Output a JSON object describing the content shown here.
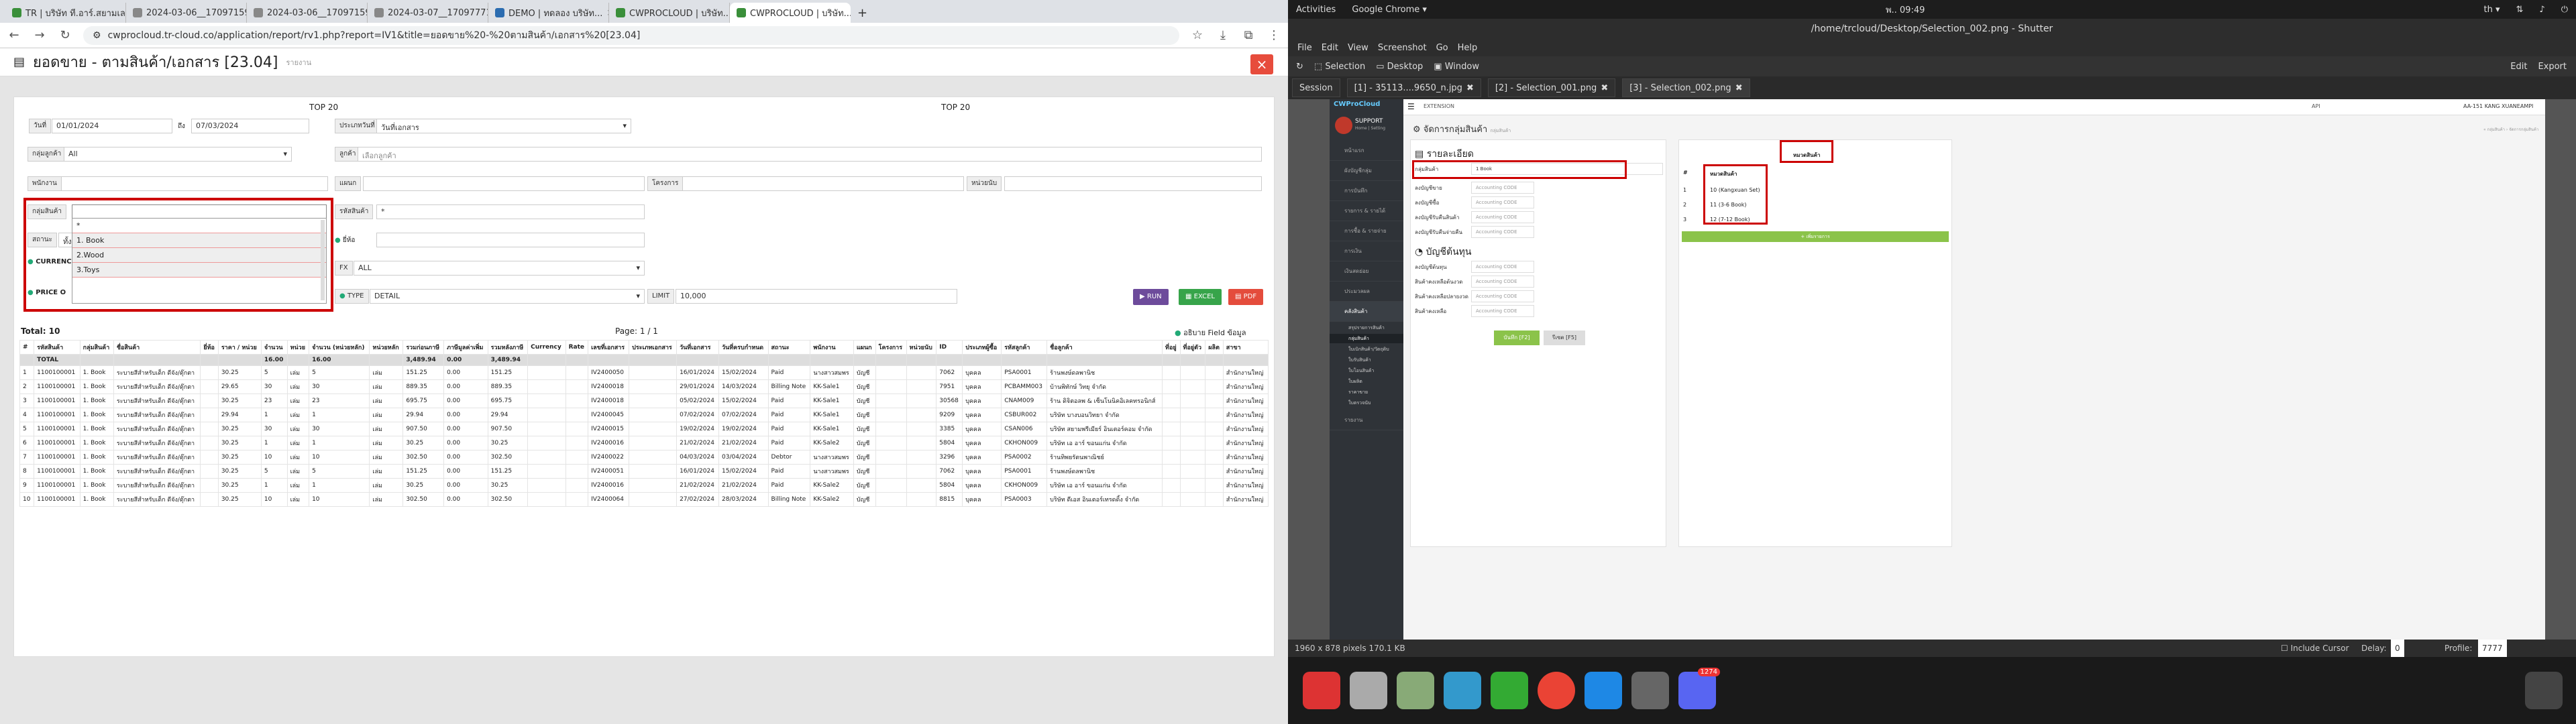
{
  "browser": {
    "tabs": [
      {
        "label": "TR | บริษัท ที.อาร์.สยามเล..."
      },
      {
        "label": "2024-03-06__17097159..."
      },
      {
        "label": "2024-03-06__17097159..."
      },
      {
        "label": "2024-03-07__17097771..."
      },
      {
        "label": "DEMO | ทดลอง บริษัท..."
      },
      {
        "label": "CWPROCLOUD | บริษัท..."
      },
      {
        "label": "CWPROCLOUD | บริษัท..."
      }
    ],
    "url": "cwprocloud.tr-cloud.co/application/report/rv1.php?report=IV1&title=ยอดขาย%20-%20ตามสินค้า/เอกสาร%20[23.04]"
  },
  "report": {
    "title": "ยอดขาย - ตามสินค้า/เอกสาร [23.04]",
    "subtitle": "รายงาน",
    "close": "×",
    "top20_left": "TOP 20",
    "top20_right": "TOP 20",
    "date_label": "วันที่",
    "date_from": "01/01/2024",
    "date_to_label": "ถึง",
    "date_to": "07/03/2024",
    "date_type_label": "ประเภทวันที่",
    "date_type_value": "วันที่เอกสาร",
    "customer_group_label": "กลุ่มลูกค้า",
    "customer_group_value": "All",
    "customer_label": "ลูกค้า",
    "customer_placeholder": "เลือกลูกค้า",
    "salesman_label": "พนักงาน",
    "dept_label": "แผนก",
    "project_label": "โครงการ",
    "job_label": "หน่วยนับ",
    "product_group_label": "กลุ่มสินค้า",
    "product_code_label": "รหัสสินค้า",
    "product_code_value": "*",
    "status_label": "สถานะ",
    "status_value": "ทั้งหมด",
    "dropdown_options": [
      "*",
      "1. Book",
      "2.Wood",
      "3.Toys"
    ],
    "currency_label": "CURRENCY",
    "price_label": "PRICE O",
    "brand_label": "ยี่ห้อ",
    "fx_label": "FX",
    "fx_value": "ALL",
    "type_label": "TYPE",
    "type_value": "DETAIL",
    "limit_label": "LIMIT",
    "limit_value": "10,000",
    "run": "RUN",
    "excel": "EXCEL",
    "pdf": "PDF",
    "total": "Total: 10",
    "page_label": "Page:",
    "page_value": "1",
    "page_of": "/ 1",
    "field_help": "อธิบาย Field ข้อมูล"
  },
  "table": {
    "headers": [
      "#",
      "รหัสสินค้า",
      "กลุ่มสินค้า",
      "ชื่อสินค้า",
      "ยี่ห้อ",
      "ราคา / หน่วย",
      "จำนวน",
      "หน่วย",
      "จำนวน (หน่วยหลัก)",
      "หน่วยหลัก",
      "รวมก่อนภาษี",
      "ภาษีมูลค่าเพิ่ม",
      "รวมหลังภาษี",
      "Currency",
      "Rate",
      "เลขที่เอกสาร",
      "ประเภทเอกสาร",
      "วันที่เอกสาร",
      "วันที่ครบกำหนด",
      "สถานะ",
      "พนักงาน",
      "แผนก",
      "โครงการ",
      "หน่วยนับ",
      "ID",
      "ประเภทผู้ซื้อ",
      "รหัสลูกค้า",
      "ชื่อลูกค้า",
      "ที่อยู่",
      "ที่อยู่ตัว",
      "ผลิต",
      "สาขา"
    ],
    "total_row": [
      "",
      "TOTAL",
      "",
      "",
      "",
      "",
      "16.00",
      "",
      "16.00",
      "",
      "3,489.94",
      "0.00",
      "3,489.94",
      "",
      "",
      "",
      "",
      "",
      "",
      "",
      "",
      "",
      "",
      "",
      "",
      "",
      "",
      "",
      "",
      "",
      "",
      ""
    ],
    "rows": [
      [
        "1",
        "1100100001",
        "1. Book",
        "ระบายสีสำหรับเด็ก ดีจัง/ตุ๊กตา",
        "",
        "30.25",
        "5",
        "เล่ม",
        "5",
        "เล่ม",
        "151.25",
        "0.00",
        "151.25",
        "",
        "",
        "IV2400050",
        "",
        "16/01/2024",
        "15/02/2024",
        "Paid",
        "นางสาวสมพร",
        "บัญชี",
        "",
        "",
        "7062",
        "บุคคล",
        "PSA0001",
        "ร้านพงษ์ดลพานิช",
        "",
        "",
        "",
        "สำนักงานใหญ่"
      ],
      [
        "2",
        "1100100001",
        "1. Book",
        "ระบายสีสำหรับเด็ก ดีจัง/ตุ๊กตา",
        "",
        "29.65",
        "30",
        "เล่ม",
        "30",
        "เล่ม",
        "889.35",
        "0.00",
        "889.35",
        "",
        "",
        "IV2400018",
        "",
        "29/01/2024",
        "14/03/2024",
        "Billing Note",
        "KK-Sale1",
        "บัญชี",
        "",
        "",
        "7951",
        "บุคคล",
        "PCBAMM003",
        "บ้านพิทักษ์ วิทยุ จำกัด",
        "",
        "",
        "",
        "สำนักงานใหญ่"
      ],
      [
        "3",
        "1100100001",
        "1. Book",
        "ระบายสีสำหรับเด็ก ดีจัง/ตุ๊กตา",
        "",
        "30.25",
        "23",
        "เล่ม",
        "23",
        "เล่ม",
        "695.75",
        "0.00",
        "695.75",
        "",
        "",
        "IV2400018",
        "",
        "05/02/2024",
        "15/02/2024",
        "Paid",
        "KK-Sale1",
        "บัญชี",
        "",
        "",
        "30568",
        "บุคคล",
        "CNAM009",
        "ร้าน ดิจิตอลพ & เซ็นโนนิคอิเลคทรอนิกส์",
        "",
        "",
        "",
        "สำนักงานใหญ่"
      ],
      [
        "4",
        "1100100001",
        "1. Book",
        "ระบายสีสำหรับเด็ก ดีจัง/ตุ๊กตา",
        "",
        "29.94",
        "1",
        "เล่ม",
        "1",
        "เล่ม",
        "29.94",
        "0.00",
        "29.94",
        "",
        "",
        "IV2400045",
        "",
        "07/02/2024",
        "07/02/2024",
        "Paid",
        "KK-Sale1",
        "บัญชี",
        "",
        "",
        "9209",
        "บุคคล",
        "CSBUR002",
        "บริษัท บางบอนวิทยา จำกัด",
        "",
        "",
        "",
        "สำนักงานใหญ่"
      ],
      [
        "5",
        "1100100001",
        "1. Book",
        "ระบายสีสำหรับเด็ก ดีจัง/ตุ๊กตา",
        "",
        "30.25",
        "30",
        "เล่ม",
        "30",
        "เล่ม",
        "907.50",
        "0.00",
        "907.50",
        "",
        "",
        "IV2400015",
        "",
        "19/02/2024",
        "19/02/2024",
        "Paid",
        "KK-Sale1",
        "บัญชี",
        "",
        "",
        "3385",
        "บุคคล",
        "CSAN006",
        "บริษัท สยามพรีเมียร์ อินเตอร์คอม จำกัด",
        "",
        "",
        "",
        "สำนักงานใหญ่"
      ],
      [
        "6",
        "1100100001",
        "1. Book",
        "ระบายสีสำหรับเด็ก ดีจัง/ตุ๊กตา",
        "",
        "30.25",
        "1",
        "เล่ม",
        "1",
        "เล่ม",
        "30.25",
        "0.00",
        "30.25",
        "",
        "",
        "IV2400016",
        "",
        "21/02/2024",
        "21/02/2024",
        "Paid",
        "KK-Sale2",
        "บัญชี",
        "",
        "",
        "5804",
        "บุคคล",
        "CKHON009",
        "บริษัท เอ อาร์ ขอนแก่น จำกัด",
        "",
        "",
        "",
        "สำนักงานใหญ่"
      ],
      [
        "7",
        "1100100001",
        "1. Book",
        "ระบายสีสำหรับเด็ก ดีจัง/ตุ๊กตา",
        "",
        "30.25",
        "10",
        "เล่ม",
        "10",
        "เล่ม",
        "302.50",
        "0.00",
        "302.50",
        "",
        "",
        "IV2400022",
        "",
        "04/03/2024",
        "03/04/2024",
        "Debtor",
        "นางสาวสมพร",
        "บัญชี",
        "",
        "",
        "3296",
        "บุคคล",
        "PSA0002",
        "ร้านทิพยรัตนพาณิชย์",
        "",
        "",
        "",
        "สำนักงานใหญ่"
      ],
      [
        "8",
        "1100100001",
        "1. Book",
        "ระบายสีสำหรับเด็ก ดีจัง/ตุ๊กตา",
        "",
        "30.25",
        "5",
        "เล่ม",
        "5",
        "เล่ม",
        "151.25",
        "0.00",
        "151.25",
        "",
        "",
        "IV2400051",
        "",
        "16/01/2024",
        "15/02/2024",
        "Paid",
        "นางสาวสมพร",
        "บัญชี",
        "",
        "",
        "7062",
        "บุคคล",
        "PSA0001",
        "ร้านพงษ์ดลพานิช",
        "",
        "",
        "",
        "สำนักงานใหญ่"
      ],
      [
        "9",
        "1100100001",
        "1. Book",
        "ระบายสีสำหรับเด็ก ดีจัง/ตุ๊กตา",
        "",
        "30.25",
        "1",
        "เล่ม",
        "1",
        "เล่ม",
        "30.25",
        "0.00",
        "30.25",
        "",
        "",
        "IV2400016",
        "",
        "21/02/2024",
        "21/02/2024",
        "Paid",
        "KK-Sale2",
        "บัญชี",
        "",
        "",
        "5804",
        "บุคคล",
        "CKHON009",
        "บริษัท เอ อาร์ ขอนแก่น จำกัด",
        "",
        "",
        "",
        "สำนักงานใหญ่"
      ],
      [
        "10",
        "1100100001",
        "1. Book",
        "ระบายสีสำหรับเด็ก ดีจัง/ตุ๊กตา",
        "",
        "30.25",
        "10",
        "เล่ม",
        "10",
        "เล่ม",
        "302.50",
        "0.00",
        "302.50",
        "",
        "",
        "IV2400064",
        "",
        "27/02/2024",
        "28/03/2024",
        "Billing Note",
        "KK-Sale2",
        "บัญชี",
        "",
        "",
        "8815",
        "บุคคล",
        "PSA0003",
        "บริษัท ดีเอส อินเตอร์เทรดดิ้ง จำกัด",
        "",
        "",
        "",
        "สำนักงานใหญ่"
      ]
    ]
  },
  "ubuntu": {
    "activities": "Activities",
    "app": "Google Chrome ▾",
    "clock": "พ.. 09:49",
    "lang": "th ▾",
    "shutter_title": "/home/trcloud/Desktop/Selection_002.png - Shutter",
    "menu": [
      "File",
      "Edit",
      "View",
      "Screenshot",
      "Go",
      "Help"
    ],
    "tools": [
      "Selection",
      "Desktop",
      "Window"
    ],
    "edit": "Edit",
    "export": "Export",
    "session_tab": "Session",
    "file_tabs": [
      "[1] - 35113....9650_n.jpg",
      "[2] - Selection_001.png",
      "[3] - Selection_002.png"
    ],
    "status": "1960 x 878 pixels  170.1 KB",
    "include_cursor": "Include Cursor",
    "delay_label": "Delay:",
    "delay_value": "0",
    "profile_label": "Profile:",
    "profile_value": "7777",
    "badge": "1274"
  },
  "erp": {
    "logo": "CWProCloud",
    "extension": "EXTENSION",
    "api": "API",
    "company": "AA-151 KANG XUANEAMPI",
    "support": "SUPPORT",
    "support_sub": "Home | Setting",
    "sidebar": [
      "หน้าแรก",
      "ผังบัญชีกลุ่ม",
      "การบันทึก",
      "รายการ & รายได้",
      "การซื้อ & รายจ่าย",
      "การเงิน",
      "เงินสดย่อย",
      "ประมวลผล",
      "คลังสินค้า",
      "รายงาน"
    ],
    "subitems": [
      "สรุปรายการสินค้า",
      "กลุ่มสินค้า",
      "ใบเบิกสินค้า/วัตถุดิบ",
      "ใบรับสินค้า",
      "ใบโอนสินค้า",
      "ใบผลิต",
      "ราคาขาย",
      "ใบตรวจนับ"
    ],
    "page_title": "จัดการกลุ่มสินค้า",
    "page_sub": "กลุ่มสินค้า",
    "breadcrumb": "« กลุ่มสินค้า › จัดการกลุ่มสินค้า",
    "detail_title": "รายละเอียด",
    "cost_title": "บัญชีต้นทุน",
    "group_label": "กลุ่มสินค้า",
    "group_value": "1 Book",
    "fields": [
      "ลงบัญชีขาย",
      "ลงบัญชีซื้อ",
      "ลงบัญชีรับคืนสินค้า",
      "ลงบัญชีรับคืนจ่ายคืน"
    ],
    "cost_fields": [
      "ลงบัญชีต้นทุน",
      "สินค้าคงเหลือต้นงวด",
      "สินค้าคงเหลือปลายงวด",
      "สินค้าคงเหลือ"
    ],
    "placeholder": "Accounting CODE",
    "save": "บันทึก [F2]",
    "reset": "รีเซต [F5]",
    "cat_header": "หมวดสินค้า",
    "cat_hash": "#",
    "cat_col": "หมวดสินค้า",
    "categories": [
      {
        "n": "1",
        "name": "10 (Kangxuan Set)"
      },
      {
        "n": "2",
        "name": "11 (3-6 Book)"
      },
      {
        "n": "3",
        "name": "12 (7-12 Book)"
      }
    ],
    "add_cat": "+ เพิ่มรายการ"
  }
}
